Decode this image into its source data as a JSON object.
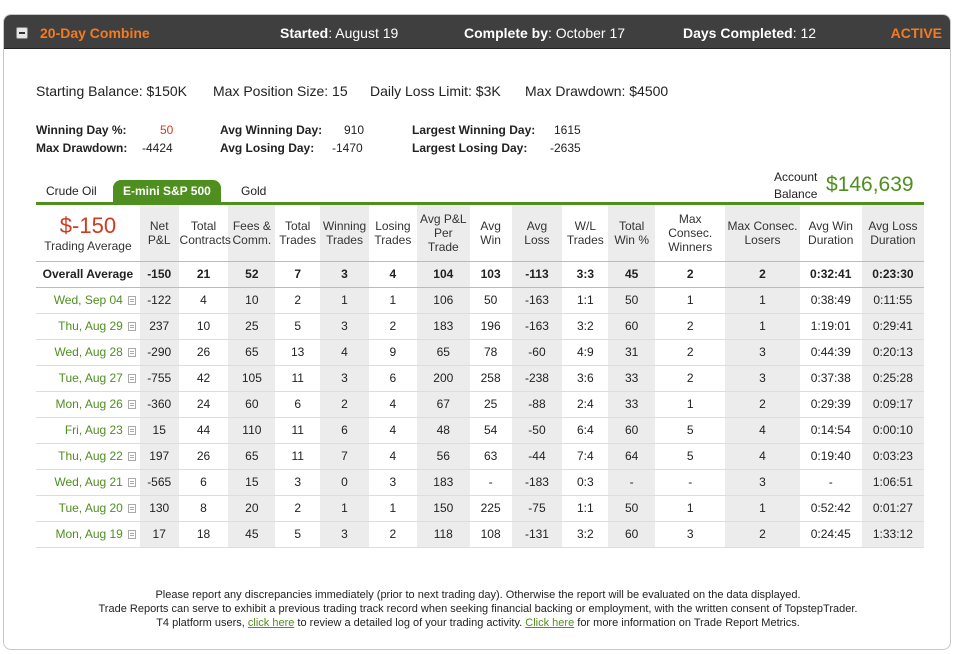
{
  "header": {
    "title": "20-Day Combine",
    "started_label": "Started",
    "started_value": ": August 19",
    "complete_label": "Complete by",
    "complete_value": ": October 17",
    "days_label": "Days Completed",
    "days_value": ": 12",
    "status": "ACTIVE"
  },
  "limits": {
    "starting_balance": "Starting Balance: $150K",
    "max_position": "Max Position Size: 15",
    "daily_loss": "Daily Loss Limit: $3K",
    "max_drawdown": "Max Drawdown: $4500"
  },
  "stats": {
    "winning_day_label": "Winning Day %:",
    "winning_day_value": "50",
    "max_drawdown_label": "Max Drawdown:",
    "max_drawdown_value": "-4424",
    "avg_winning_label": "Avg Winning Day:",
    "avg_winning_value": "910",
    "avg_losing_label": "Avg Losing Day:",
    "avg_losing_value": "-1470",
    "largest_winning_label": "Largest Winning Day:",
    "largest_winning_value": "1615",
    "largest_losing_label": "Largest Losing Day:",
    "largest_losing_value": "-2635"
  },
  "tabs": [
    "Crude Oil",
    "E-mini S&P 500",
    "Gold"
  ],
  "active_tab": "E-mini S&P 500",
  "account": {
    "label_line1": "Account",
    "label_line2": "Balance",
    "value": "$146,639"
  },
  "table": {
    "trading_avg_value": "$-150",
    "trading_avg_label": "Trading Average",
    "headers": [
      [
        "Net",
        "P&L"
      ],
      [
        "Total",
        "Contracts"
      ],
      [
        "Fees &",
        "Comm."
      ],
      [
        "Total",
        "Trades"
      ],
      [
        "Winning",
        "Trades"
      ],
      [
        "Losing",
        "Trades"
      ],
      [
        "Avg P&L",
        "Per",
        "Trade"
      ],
      [
        "Avg",
        "Win"
      ],
      [
        "Avg",
        "Loss"
      ],
      [
        "W/L",
        "Trades"
      ],
      [
        "Total",
        "Win %"
      ],
      [
        "Max Consec.",
        "Winners"
      ],
      [
        "Max Consec.",
        "Losers"
      ],
      [
        "Avg Win",
        "Duration"
      ],
      [
        "Avg Loss",
        "Duration"
      ]
    ],
    "overall_label": "Overall Average",
    "overall": [
      "-150",
      "21",
      "52",
      "7",
      "3",
      "4",
      "104",
      "103",
      "-113",
      "3:3",
      "45",
      "2",
      "2",
      "0:32:41",
      "0:23:30"
    ],
    "rows": [
      {
        "date": "Wed, Sep 04",
        "cells": [
          "-122",
          "4",
          "10",
          "2",
          "1",
          "1",
          "106",
          "50",
          "-163",
          "1:1",
          "50",
          "1",
          "1",
          "0:38:49",
          "0:11:55"
        ]
      },
      {
        "date": "Thu, Aug 29",
        "cells": [
          "237",
          "10",
          "25",
          "5",
          "3",
          "2",
          "183",
          "196",
          "-163",
          "3:2",
          "60",
          "2",
          "1",
          "1:19:01",
          "0:29:41"
        ]
      },
      {
        "date": "Wed, Aug 28",
        "cells": [
          "-290",
          "26",
          "65",
          "13",
          "4",
          "9",
          "65",
          "78",
          "-60",
          "4:9",
          "31",
          "2",
          "3",
          "0:44:39",
          "0:20:13"
        ]
      },
      {
        "date": "Tue, Aug 27",
        "cells": [
          "-755",
          "42",
          "105",
          "11",
          "3",
          "6",
          "200",
          "258",
          "-238",
          "3:6",
          "33",
          "2",
          "3",
          "0:37:38",
          "0:25:28"
        ]
      },
      {
        "date": "Mon, Aug 26",
        "cells": [
          "-360",
          "24",
          "60",
          "6",
          "2",
          "4",
          "67",
          "25",
          "-88",
          "2:4",
          "33",
          "1",
          "2",
          "0:29:39",
          "0:09:17"
        ]
      },
      {
        "date": "Fri, Aug 23",
        "cells": [
          "15",
          "44",
          "110",
          "11",
          "6",
          "4",
          "48",
          "54",
          "-50",
          "6:4",
          "60",
          "5",
          "4",
          "0:14:54",
          "0:00:10"
        ]
      },
      {
        "date": "Thu, Aug 22",
        "cells": [
          "197",
          "26",
          "65",
          "11",
          "7",
          "4",
          "56",
          "63",
          "-44",
          "7:4",
          "64",
          "5",
          "4",
          "0:19:40",
          "0:03:23"
        ]
      },
      {
        "date": "Wed, Aug 21",
        "cells": [
          "-565",
          "6",
          "15",
          "3",
          "0",
          "3",
          "183",
          "-",
          "-183",
          "0:3",
          "-",
          "-",
          "3",
          "-",
          "1:06:51"
        ]
      },
      {
        "date": "Tue, Aug 20",
        "cells": [
          "130",
          "8",
          "20",
          "2",
          "1",
          "1",
          "150",
          "225",
          "-75",
          "1:1",
          "50",
          "1",
          "1",
          "0:52:42",
          "0:01:27"
        ]
      },
      {
        "date": "Mon, Aug 19",
        "cells": [
          "17",
          "18",
          "45",
          "5",
          "3",
          "2",
          "118",
          "108",
          "-131",
          "3:2",
          "60",
          "3",
          "2",
          "0:24:45",
          "1:33:12"
        ]
      }
    ]
  },
  "footer": {
    "line1": "Please report any discrepancies immediately (prior to next trading day). Otherwise the report will be evaluated on the data displayed.",
    "line2": "Trade Reports can serve to exhibit a previous trading track record when seeking financial backing or employment, with the written consent of TopstepTrader.",
    "line3_a": "T4 platform users, ",
    "link1": "click here",
    "line3_b": " to review a detailed log of your trading activity. ",
    "link2": "Click here",
    "line3_c": " for more information on Trade Report Metrics."
  }
}
